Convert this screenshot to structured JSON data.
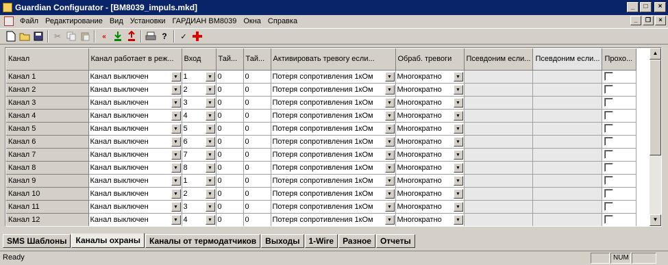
{
  "window": {
    "title": "Guardian Configurator - [BM8039_impuls.mkd]"
  },
  "menu": [
    "Файл",
    "Редактирование",
    "Вид",
    "Установки",
    "ГАРДИАН BM8039",
    "Окна",
    "Справка"
  ],
  "toolbar": {
    "icons": [
      "new-icon",
      "open-icon",
      "save-icon",
      "cut-icon",
      "copy-icon",
      "paste-icon",
      "rewind-icon",
      "download-icon",
      "upload-icon",
      "print-icon",
      "help-icon",
      "check-icon",
      "red-cross-icon"
    ]
  },
  "grid": {
    "headers": [
      "Канал",
      "Канал работает в реж...",
      "Вход",
      "Тай...",
      "Тай...",
      "Активировать тревогу если...",
      "Обраб. тревоги",
      "Псевдоним если...",
      "Псевдоним если...",
      "Прохо..."
    ],
    "rows": [
      {
        "name": "Канал 1",
        "mode": "Канал выключен",
        "input": "1",
        "t1": "0",
        "t2": "0",
        "activate": "Потеря сопротивления 1кОм",
        "handling": "Многократно"
      },
      {
        "name": "Канал 2",
        "mode": "Канал выключен",
        "input": "2",
        "t1": "0",
        "t2": "0",
        "activate": "Потеря сопротивления 1кОм",
        "handling": "Многократно"
      },
      {
        "name": "Канал 3",
        "mode": "Канал выключен",
        "input": "3",
        "t1": "0",
        "t2": "0",
        "activate": "Потеря сопротивления 1кОм",
        "handling": "Многократно"
      },
      {
        "name": "Канал 4",
        "mode": "Канал выключен",
        "input": "4",
        "t1": "0",
        "t2": "0",
        "activate": "Потеря сопротивления 1кОм",
        "handling": "Многократно"
      },
      {
        "name": "Канал 5",
        "mode": "Канал выключен",
        "input": "5",
        "t1": "0",
        "t2": "0",
        "activate": "Потеря сопротивления 1кОм",
        "handling": "Многократно"
      },
      {
        "name": "Канал 6",
        "mode": "Канал выключен",
        "input": "6",
        "t1": "0",
        "t2": "0",
        "activate": "Потеря сопротивления 1кОм",
        "handling": "Многократно"
      },
      {
        "name": "Канал 7",
        "mode": "Канал выключен",
        "input": "7",
        "t1": "0",
        "t2": "0",
        "activate": "Потеря сопротивления 1кОм",
        "handling": "Многократно"
      },
      {
        "name": "Канал 8",
        "mode": "Канал выключен",
        "input": "8",
        "t1": "0",
        "t2": "0",
        "activate": "Потеря сопротивления 1кОм",
        "handling": "Многократно"
      },
      {
        "name": "Канал 9",
        "mode": "Канал выключен",
        "input": "1",
        "t1": "0",
        "t2": "0",
        "activate": "Потеря сопротивления 1кОм",
        "handling": "Многократно"
      },
      {
        "name": "Канал 10",
        "mode": "Канал выключен",
        "input": "2",
        "t1": "0",
        "t2": "0",
        "activate": "Потеря сопротивления 1кОм",
        "handling": "Многократно"
      },
      {
        "name": "Канал 11",
        "mode": "Канал выключен",
        "input": "3",
        "t1": "0",
        "t2": "0",
        "activate": "Потеря сопротивления 1кОм",
        "handling": "Многократно"
      },
      {
        "name": "Канал 12",
        "mode": "Канал выключен",
        "input": "4",
        "t1": "0",
        "t2": "0",
        "activate": "Потеря сопротивления 1кОм",
        "handling": "Многократно"
      }
    ]
  },
  "tabs": [
    {
      "label": "SMS Шаблоны",
      "active": false
    },
    {
      "label": "Каналы охраны",
      "active": true
    },
    {
      "label": "Каналы от термодатчиков",
      "active": false
    },
    {
      "label": "Выходы",
      "active": false
    },
    {
      "label": "1-Wire",
      "active": false
    },
    {
      "label": "Разное",
      "active": false
    },
    {
      "label": "Отчеты",
      "active": false
    }
  ],
  "status": {
    "text": "Ready",
    "num": "NUM"
  }
}
